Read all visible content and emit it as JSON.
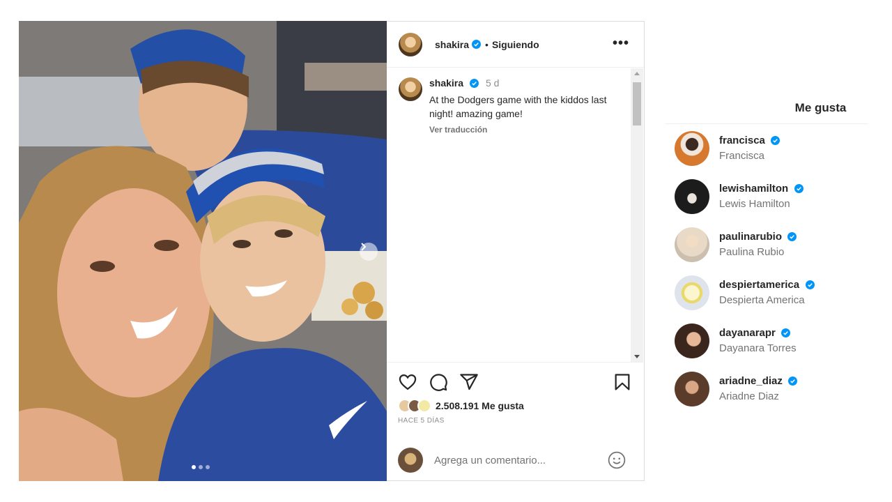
{
  "post": {
    "username": "shakira",
    "follow_status": "Siguiendo",
    "more_icon": "more-horizontal-icon",
    "caption": {
      "username": "shakira",
      "time": "5 d",
      "text": "At the Dodgers game with the kiddos last night! amazing game!",
      "translate": "Ver traducción"
    },
    "likes_count": "2.508.191 Me gusta",
    "time_ago": "HACE 5 DÍAS",
    "comment_placeholder": "Agrega un comentario...",
    "carousel": {
      "current": 1,
      "total": 3
    }
  },
  "likes_panel": {
    "title": "Me gusta",
    "users": [
      {
        "username": "francisca",
        "full_name": "Francisca",
        "verified": true,
        "color": "#d7782f"
      },
      {
        "username": "lewishamilton",
        "full_name": "Lewis Hamilton",
        "verified": true,
        "color": "#1c1c1c"
      },
      {
        "username": "paulinarubio",
        "full_name": "Paulina Rubio",
        "verified": true,
        "color": "#e6ddd2"
      },
      {
        "username": "despiertamerica",
        "full_name": "Despierta America",
        "verified": true,
        "color": "#f2e9a4"
      },
      {
        "username": "dayanarapr",
        "full_name": "Dayanara Torres",
        "verified": true,
        "color": "#5c3b2c"
      },
      {
        "username": "ariadne_diaz",
        "full_name": "Ariadne Diaz",
        "verified": true,
        "color": "#6b4a36"
      }
    ]
  },
  "colors": {
    "verified": "#0095f6",
    "muted": "#737373",
    "border": "#dbdbdb"
  }
}
